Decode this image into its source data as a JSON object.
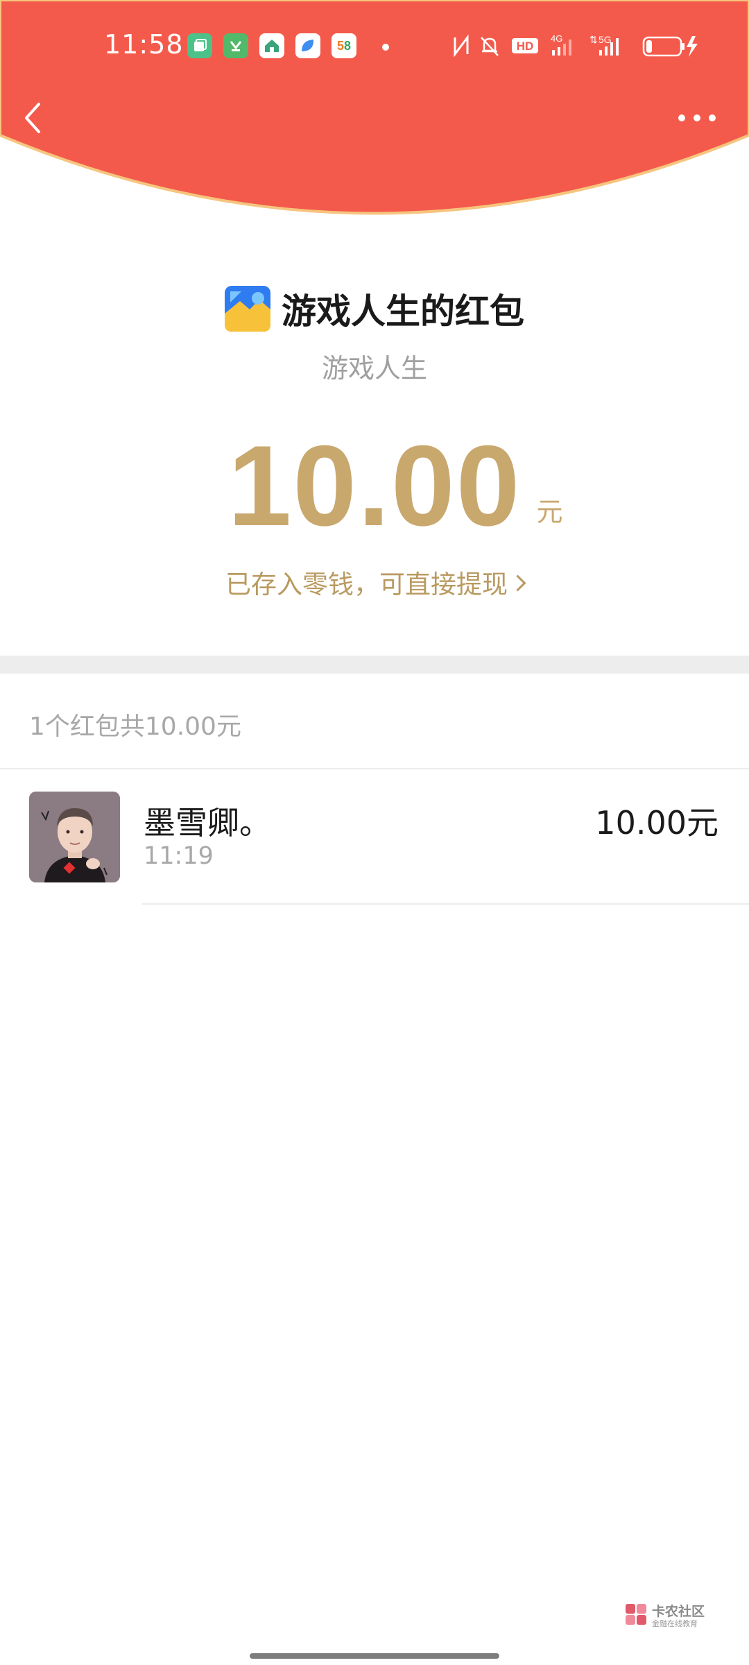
{
  "status_bar": {
    "time": "11:58",
    "app_icons": [
      {
        "name": "gallery-app-icon",
        "color": "#4cc28a",
        "glyph": ""
      },
      {
        "name": "vip-app-icon",
        "color": "#52b96b",
        "glyph": ""
      },
      {
        "name": "home-app-icon",
        "color": "#3aa57a",
        "glyph": ""
      },
      {
        "name": "browser-app-icon",
        "color": "#3d8ef0",
        "glyph": ""
      },
      {
        "name": "58-app-icon",
        "color": "#ffffff",
        "glyph": "58"
      }
    ],
    "network_labels": {
      "hd": "HD",
      "net1": "4G",
      "net2": "5G"
    }
  },
  "header": {
    "color": "#f45a4b",
    "border_color": "#f6c57e"
  },
  "packet": {
    "title": "游戏人生的红包",
    "subtitle": "游戏人生",
    "amount": "10.00",
    "unit": "元",
    "deposit_text": "已存入零钱，可直接提现"
  },
  "summary": {
    "text": "1个红包共10.00元"
  },
  "records": [
    {
      "name": "墨雪卿。",
      "time": "11:19",
      "amount": "10.00元"
    }
  ],
  "watermark": {
    "title": "卡农社区",
    "subtitle": "金融在线教育"
  }
}
